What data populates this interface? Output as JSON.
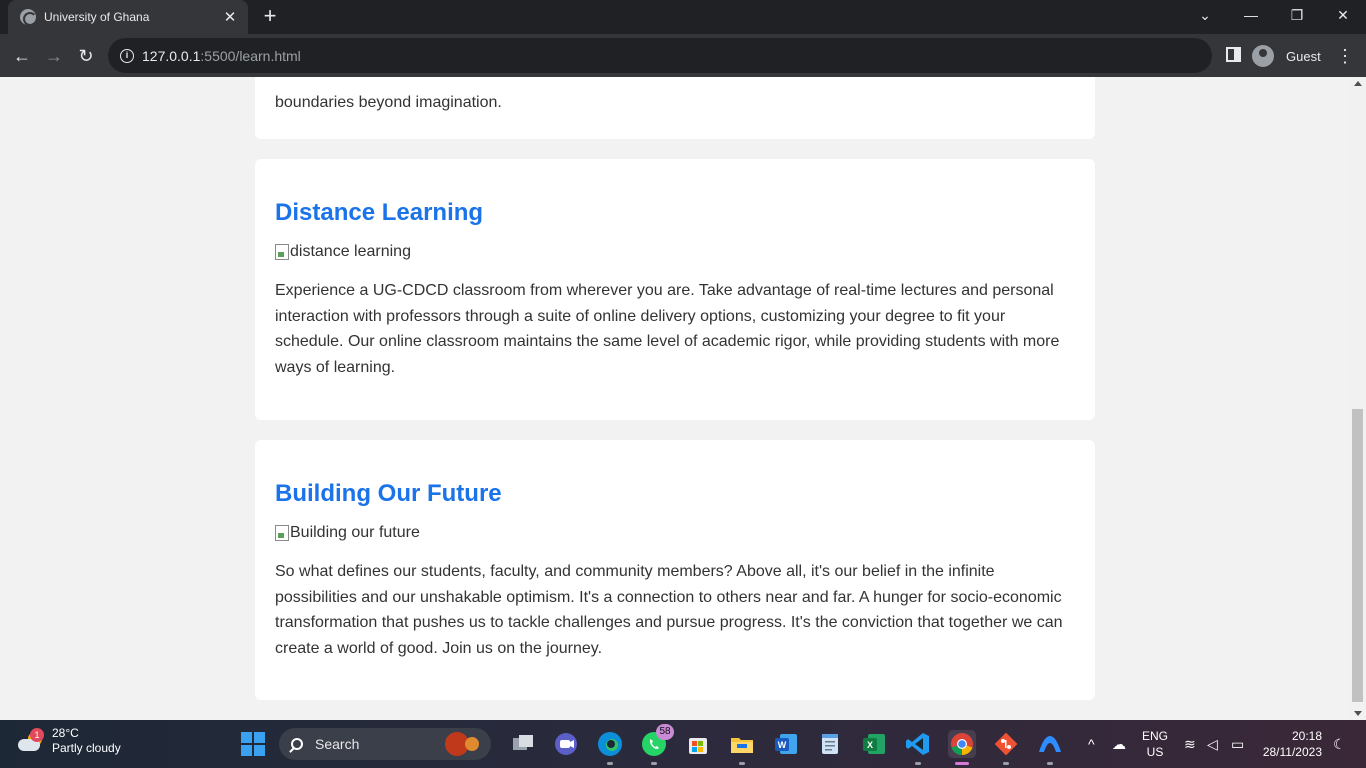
{
  "browser": {
    "tab_title": "University of Ghana",
    "tab_close": "✕",
    "new_tab": "+",
    "url_host": "127.0.0.1",
    "url_path": ":5500/learn.html",
    "profile_label": "Guest",
    "window_controls": {
      "tab_search": "⌄",
      "minimize": "—",
      "restore": "❐",
      "close": "✕"
    },
    "nav": {
      "back": "←",
      "forward": "→",
      "reload": "↻",
      "menu": "⋮"
    }
  },
  "page": {
    "prev_section_tail": "boundaries beyond imagination.",
    "sections": [
      {
        "heading": "Distance Learning",
        "image_alt": "distance learning",
        "body": "Experience a UG-CDCD classroom from wherever you are. Take advantage of real-time lectures and personal interaction with professors through a suite of online delivery options, customizing your degree to fit your schedule. Our online classroom maintains the same level of academic rigor, while providing students with more ways of learning."
      },
      {
        "heading": "Building Our Future",
        "image_alt": "Building our future",
        "body": "So what defines our students, faculty, and community members? Above all, it's our belief in the infinite possibilities and our unshakable optimism. It's a connection to others near and far. A hunger for socio-economic transformation that pushes us to tackle challenges and pursue progress. It's the conviction that together we can create a world of good. Join us on the journey."
      }
    ],
    "heading_color": "#1a73e8"
  },
  "taskbar": {
    "weather_temp": "28°C",
    "weather_desc": "Partly cloudy",
    "weather_badge": "1",
    "search_label": "Search",
    "whatsapp_badge": "58",
    "lang_primary": "ENG",
    "lang_secondary": "US",
    "time": "20:18",
    "date": "28/11/2023",
    "apps": [
      "task-view",
      "teams-chat",
      "edge",
      "whatsapp",
      "microsoft-store",
      "file-explorer",
      "word",
      "notepad",
      "excel",
      "vscode",
      "chrome",
      "git",
      "vpn"
    ]
  }
}
